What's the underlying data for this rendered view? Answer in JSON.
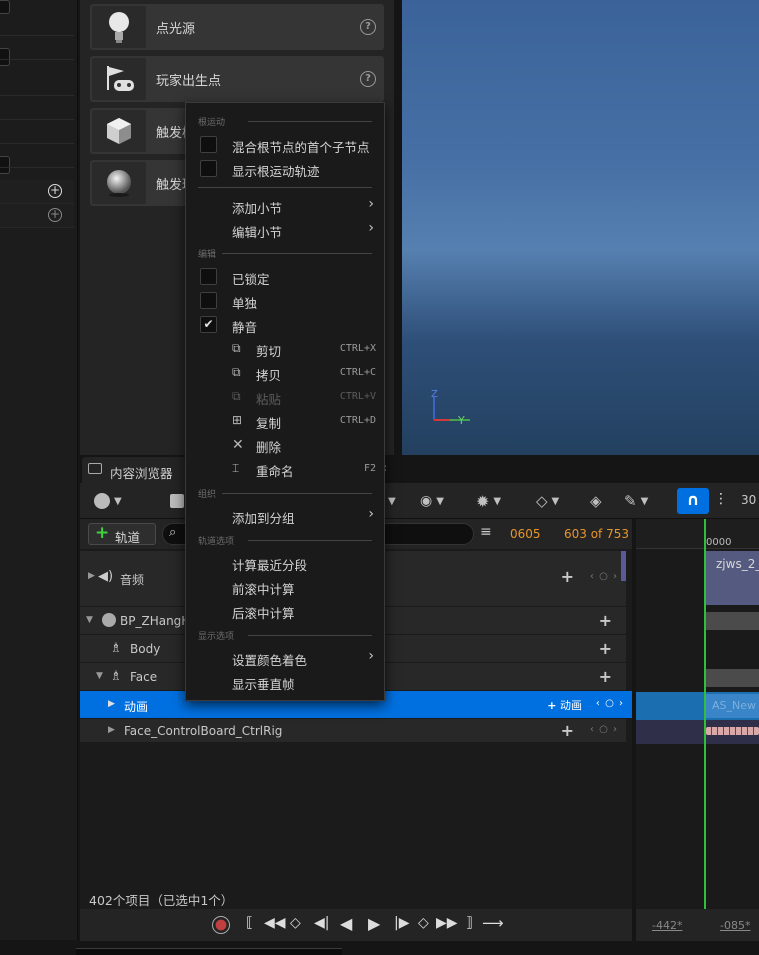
{
  "place_actors": {
    "items": [
      {
        "label": "点光源",
        "icon": "bulb-icon"
      },
      {
        "label": "玩家出生点",
        "icon": "flag-gamepad-icon"
      },
      {
        "label": "触发框",
        "icon": "cube-icon"
      },
      {
        "label": "触发球",
        "icon": "sphere-icon"
      }
    ],
    "help_glyph": "?"
  },
  "viewport": {
    "axis_z": "Z",
    "axis_y": "Y"
  },
  "content_browser": {
    "tab_label": "内容浏览器",
    "status": "402个项目（已选中1个）"
  },
  "sequencer": {
    "add_track_label": "轨道",
    "current_frame": "0605",
    "frame_count": "603 of 753",
    "fps": "30",
    "timeline_start": "0000",
    "rows": [
      {
        "label": "音频",
        "nav": "‹ ○ ›"
      },
      {
        "label": "BP_ZHangH"
      },
      {
        "label": "Body"
      },
      {
        "label": "Face"
      },
      {
        "label": "动画",
        "add_label": "动画",
        "nav": "‹ ○ ›"
      },
      {
        "label": "Face_ControlBoard_CtrlRig",
        "nav": "‹ ○ ›"
      }
    ],
    "clips": {
      "audio": "zjws_2_",
      "anim": "AS_New"
    },
    "bottom_left": "-442*",
    "bottom_right": "-085*"
  },
  "context_menu": {
    "sections": {
      "root_motion": "根运动",
      "edit": "编辑",
      "organize": "组织",
      "track_options": "轨道选项",
      "display_options": "显示选项"
    },
    "blend_first_child": "混合根节点的首个子节点",
    "show_root_motion_trail": "显示根运动轨迹",
    "add_section": "添加小节",
    "edit_section": "编辑小节",
    "locked": "已锁定",
    "solo": "单独",
    "mute": "静音",
    "mute_check": "✔",
    "cut": "剪切",
    "cut_sc": "CTRL+X",
    "copy": "拷贝",
    "copy_sc": "CTRL+C",
    "paste": "粘贴",
    "paste_sc": "CTRL+V",
    "duplicate": "复制",
    "duplicate_sc": "CTRL+D",
    "delete": "删除",
    "rename": "重命名",
    "rename_sc": "F2",
    "add_to_group": "添加到分组",
    "calc_recent": "计算最近分段",
    "pre_roll": "前滚中计算",
    "post_roll": "后滚中计算",
    "set_color_tint": "设置颜色着色",
    "show_vertical_frames": "显示垂直帧"
  },
  "colors": {
    "accent_blue": "#0070e0",
    "frame_orange": "#e8962a",
    "playhead_green": "#2fbf3a"
  }
}
